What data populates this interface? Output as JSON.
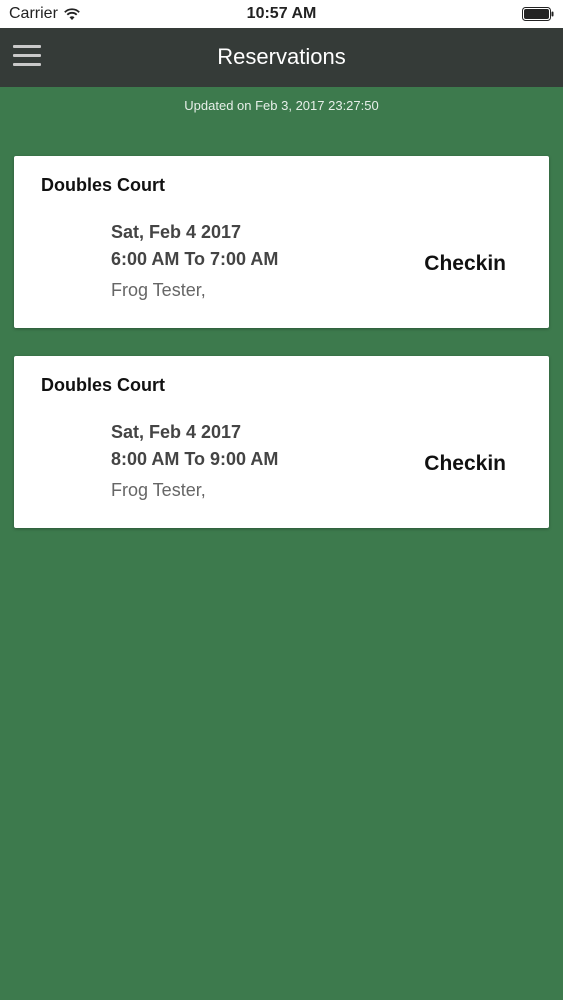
{
  "status_bar": {
    "carrier": "Carrier",
    "time": "10:57 AM"
  },
  "nav": {
    "title": "Reservations"
  },
  "updated_text": "Updated on Feb 3, 2017 23:27:50",
  "reservations": [
    {
      "court": "Doubles Court",
      "date": "Sat, Feb 4 2017",
      "time": "6:00 AM To 7:00 AM",
      "person": "Frog Tester,",
      "action": "Checkin"
    },
    {
      "court": "Doubles Court",
      "date": "Sat, Feb 4 2017",
      "time": "8:00 AM To 9:00 AM",
      "person": "Frog Tester,",
      "action": "Checkin"
    }
  ],
  "colors": {
    "background": "#3d7a4d",
    "nav_bar": "#353b38",
    "card": "#ffffff"
  }
}
